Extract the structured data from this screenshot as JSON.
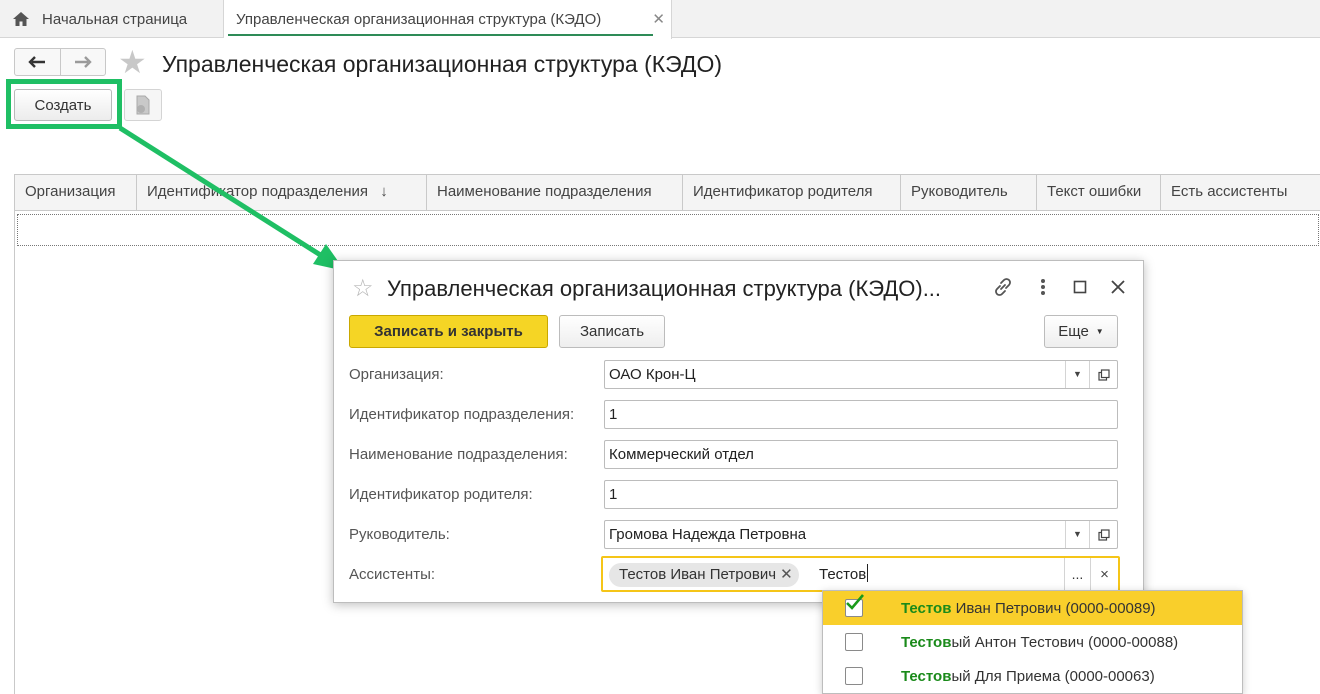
{
  "tabs": {
    "home": "Начальная страница",
    "active": "Управленческая организационная структура (КЭДО)"
  },
  "page": {
    "title": "Управленческая организационная структура (КЭДО)",
    "create_label": "Создать"
  },
  "grid": {
    "columns": [
      "Организация",
      "Идентификатор подразделения",
      "Наименование подразделения",
      "Идентификатор родителя",
      "Руководитель",
      "Текст ошибки",
      "Есть ассистенты"
    ],
    "sort_indicator": "↓"
  },
  "dialog": {
    "title": "Управленческая организационная структура (КЭДО)...",
    "save_close_label": "Записать и закрыть",
    "save_label": "Записать",
    "more_label": "Еще",
    "fields": {
      "org_label": "Организация:",
      "org_value": "ОАО Крон-Ц",
      "dept_id_label": "Идентификатор подразделения:",
      "dept_id_value": "1",
      "dept_name_label": "Наименование подразделения:",
      "dept_name_value": "Коммерческий отдел",
      "parent_id_label": "Идентификатор родителя:",
      "parent_id_value": "1",
      "head_label": "Руководитель:",
      "head_value": "Громова Надежда Петровна",
      "assistants_label": "Ассистенты:",
      "assistant_chip": "Тестов Иван Петрович",
      "assistant_input": "Тестов",
      "more_dots": "...",
      "clear": "×"
    }
  },
  "dropdown": {
    "items": [
      {
        "match": "Тестов",
        "rest": " Иван Петрович (0000-00089)",
        "checked": true
      },
      {
        "match": "Тестов",
        "rest": "ый Антон Тестович (0000-00088)",
        "checked": false
      },
      {
        "match": "Тестов",
        "rest": "ый Для Приема (0000-00063)",
        "checked": false
      }
    ]
  },
  "colors": {
    "highlight": "#1fbf64",
    "primary_button": "#f5d525",
    "selected_row": "#f9cf2b",
    "match_text": "#1a8a1a"
  }
}
